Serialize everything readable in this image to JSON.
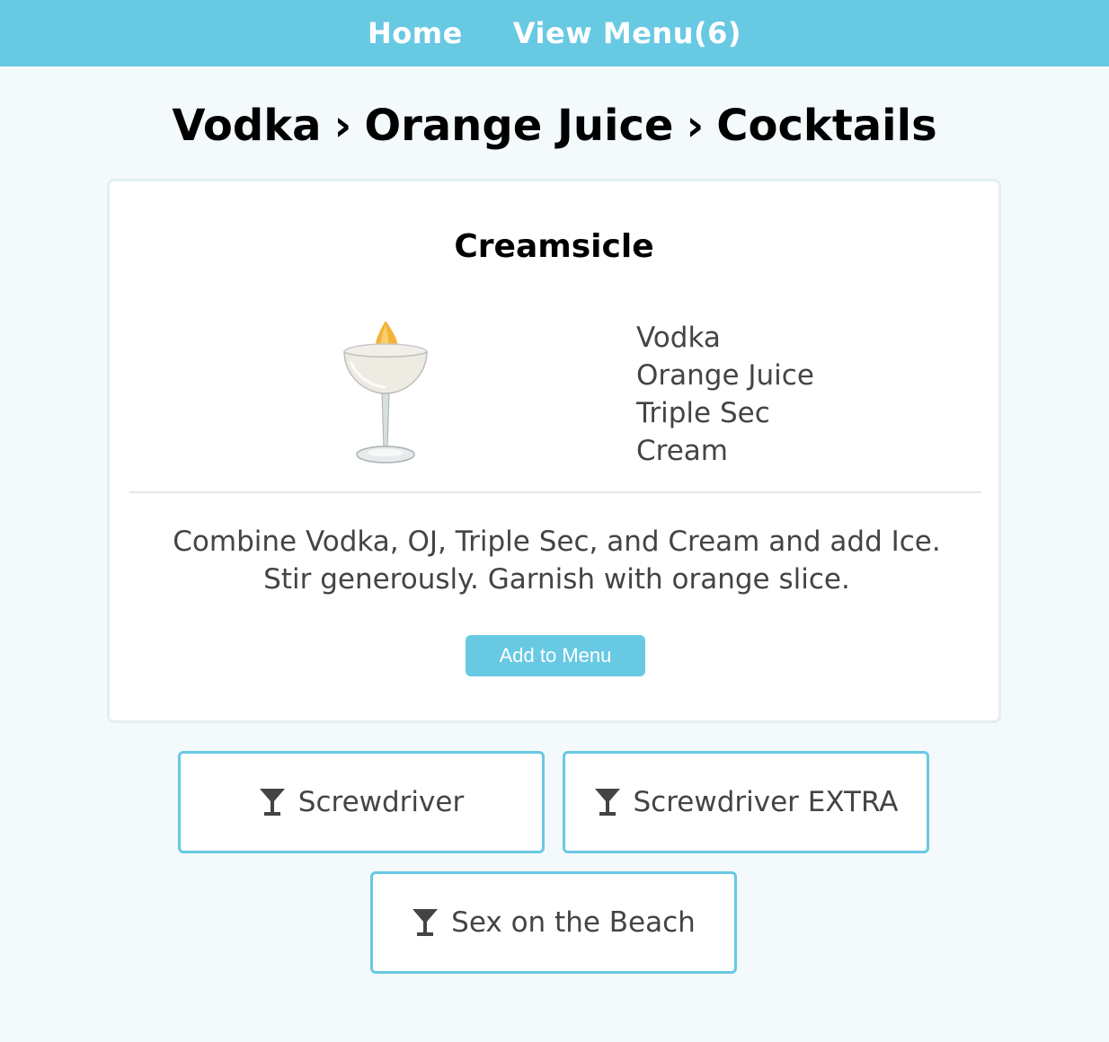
{
  "nav": {
    "home_label": "Home",
    "view_menu_label": "View Menu(6)"
  },
  "breadcrumb": {
    "spirit": "Vodka",
    "separator": "›",
    "mixer": "Orange Juice",
    "section": "Cocktails"
  },
  "cocktail": {
    "name": "Creamsicle",
    "image_icon": "coupe-glass-with-orange-garnish",
    "ingredients": [
      "Vodka",
      "Orange Juice",
      "Triple Sec",
      "Cream"
    ],
    "instructions": "Combine Vodka, OJ, Triple Sec, and Cream and add Ice. Stir generously. Garnish with orange slice.",
    "add_button_label": "Add to Menu"
  },
  "related": {
    "icon": "cocktail-glass-icon",
    "items": [
      {
        "label": "Screwdriver"
      },
      {
        "label": "Screwdriver EXTRA"
      },
      {
        "label": "Sex on the Beach"
      }
    ]
  },
  "colors": {
    "accent": "#68c9e3",
    "background": "#f4f9fc",
    "card_border": "#e3eff3",
    "text": "#444444",
    "heading": "#000000"
  }
}
